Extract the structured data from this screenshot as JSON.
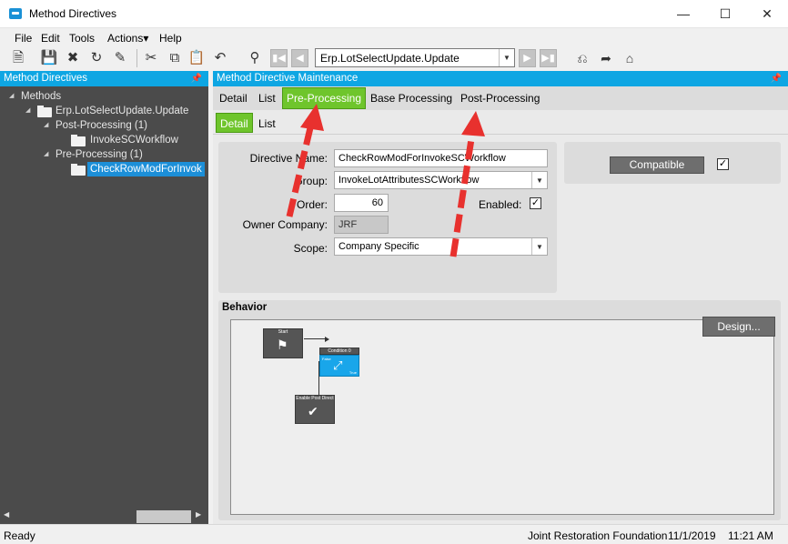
{
  "window": {
    "title": "Method Directives"
  },
  "menu": [
    "File",
    "Edit",
    "Tools",
    "Actions▾",
    "Help"
  ],
  "toolbar": {
    "method_value": "Erp.LotSelectUpdate.Update"
  },
  "left_pane": {
    "header": "Method Directives",
    "tree": [
      {
        "label": "Methods"
      },
      {
        "label": "Erp.LotSelectUpdate.Update"
      },
      {
        "label": "Post-Processing (1)"
      },
      {
        "label": "InvokeSCWorkflow"
      },
      {
        "label": "Pre-Processing (1)"
      },
      {
        "label": "CheckRowModForInvok"
      }
    ]
  },
  "right_pane": {
    "header": "Method Directive Maintenance",
    "tabs": [
      "Detail",
      "List",
      "Pre-Processing",
      "Base Processing",
      "Post-Processing"
    ],
    "subtabs": [
      "Detail",
      "List"
    ]
  },
  "form": {
    "directive_name_label": "Directive Name:",
    "directive_name_value": "CheckRowModForInvokeSCWorkflow",
    "group_label": "Group:",
    "group_value": "InvokeLotAttributesSCWorkflow",
    "order_label": "Order:",
    "order_value": "60",
    "enabled_label": "Enabled:",
    "owner_company_label": "Owner Company:",
    "owner_company_value": "JRF",
    "scope_label": "Scope:",
    "scope_value": "Company Specific",
    "compatible_label": "Compatible"
  },
  "behavior": {
    "title": "Behavior",
    "design_button": "Design...",
    "nodes": [
      "Start",
      "Condition 0",
      "Enable Post Direct"
    ],
    "labels": {
      "false": "False",
      "true": "True"
    }
  },
  "status": {
    "ready": "Ready",
    "company": "Joint Restoration Foundation",
    "date": "11/1/2019",
    "time": "11:21 AM"
  },
  "colors": {
    "accent_blue": "#0ea6e3",
    "tab_green": "#6fc52c",
    "arrow_red": "#e8312e"
  }
}
